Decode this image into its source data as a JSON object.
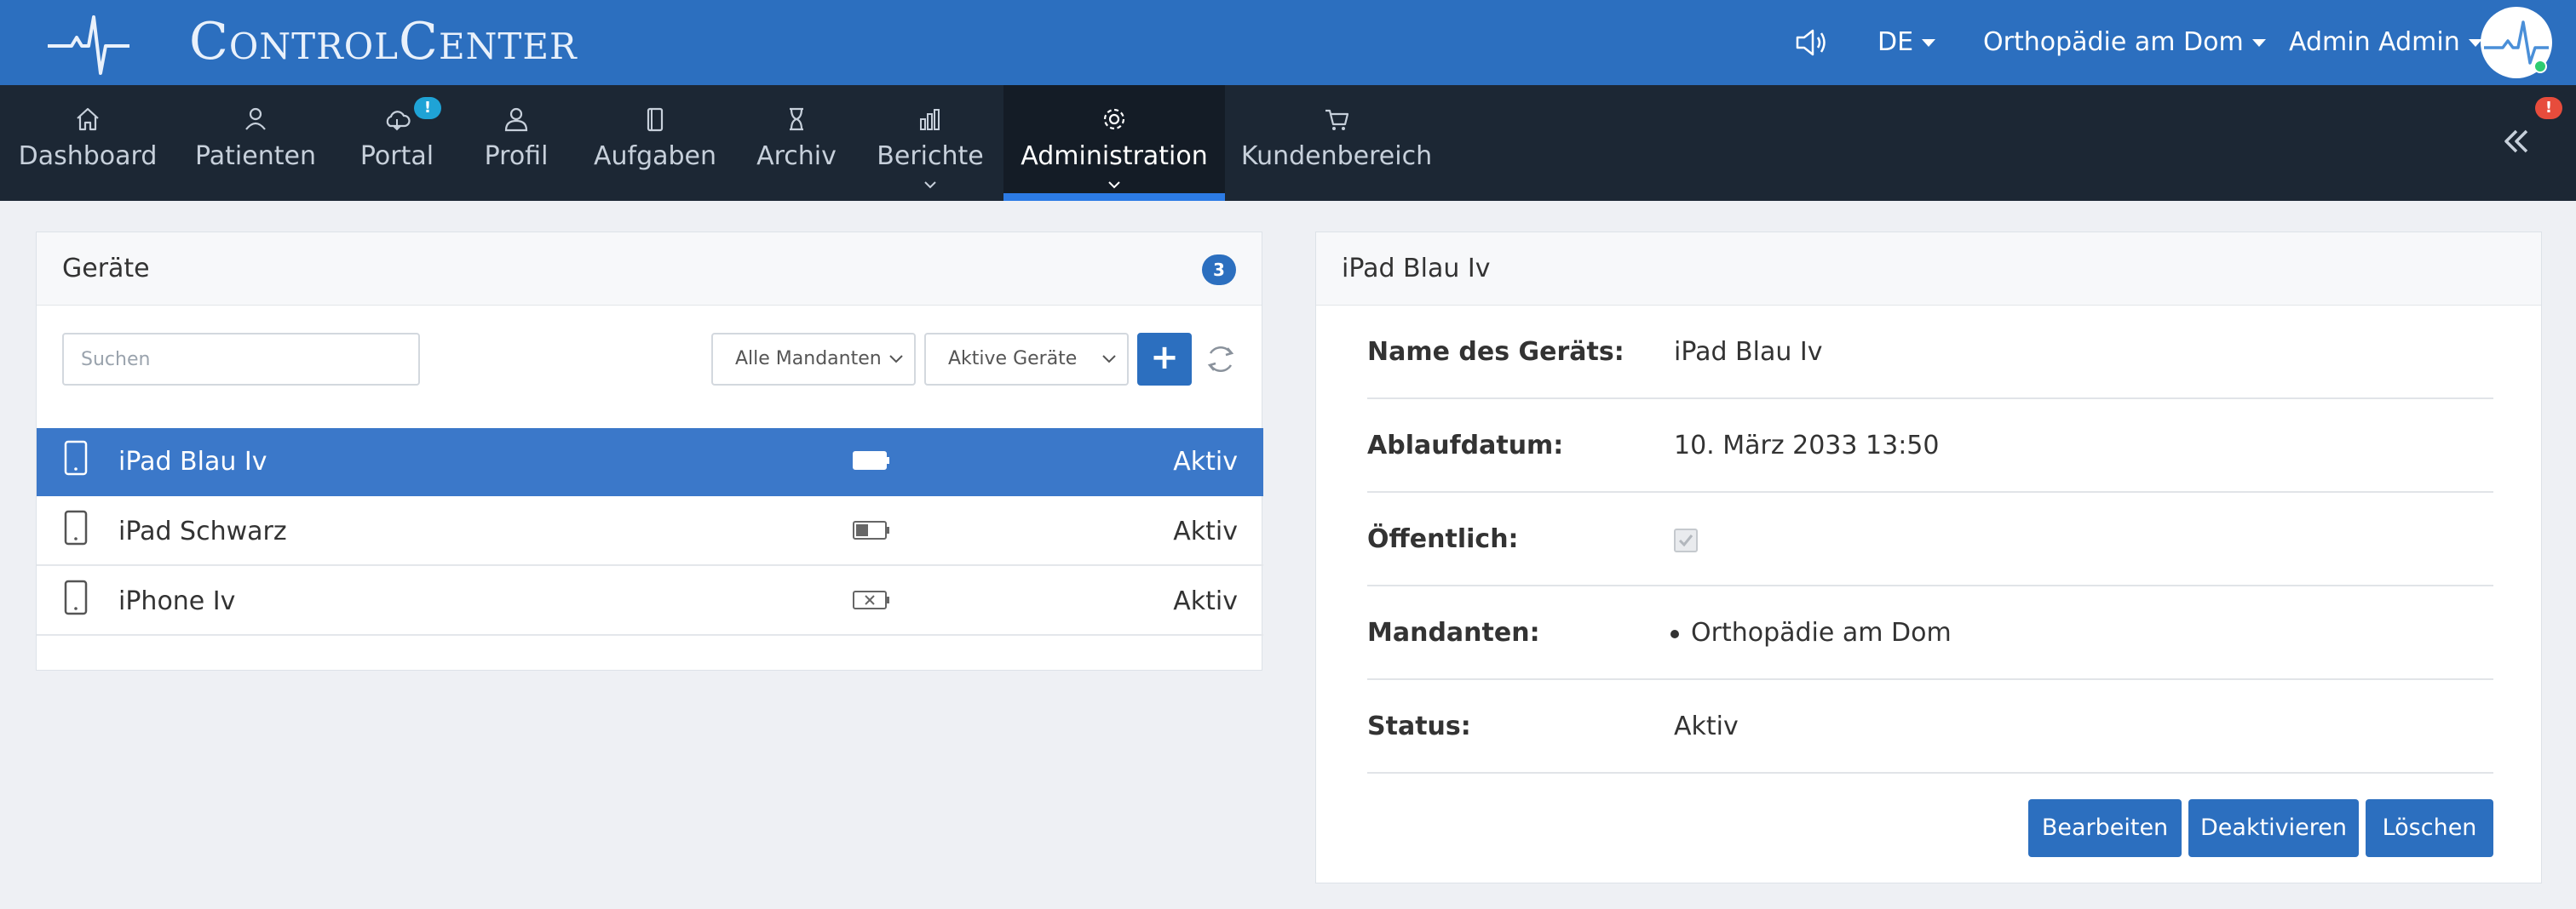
{
  "app": {
    "title": "ControlCenter",
    "accent": "#2c6fbf",
    "nav_bg": "#1c2734"
  },
  "header": {
    "language": "DE",
    "organization": "Orthopädie am Dom",
    "user": "Admin Admin",
    "icons": [
      "pulse-logo-icon",
      "speaker-icon",
      "avatar"
    ]
  },
  "nav": {
    "items": [
      {
        "label": "Dashboard",
        "icon": "home-icon"
      },
      {
        "label": "Patienten",
        "icon": "users-icon"
      },
      {
        "label": "Portal",
        "icon": "cloud-icon",
        "badge": "!"
      },
      {
        "label": "Profil",
        "icon": "user-icon"
      },
      {
        "label": "Aufgaben",
        "icon": "clipboard-icon"
      },
      {
        "label": "Archiv",
        "icon": "hourglass-icon"
      },
      {
        "label": "Berichte",
        "icon": "bar-chart-icon"
      },
      {
        "label": "Administration",
        "icon": "gear-icon"
      },
      {
        "label": "Kundenbereich",
        "icon": "cart-icon"
      }
    ],
    "active": "Administration",
    "collapse_badge": "!"
  },
  "devices_panel": {
    "title": "Geräte",
    "count": "3",
    "search_placeholder": "Suchen",
    "filter_clients": "Alle Mandanten",
    "filter_status": "Aktive Geräte",
    "add_label": "+",
    "rows": [
      {
        "name": "iPad Blau Iv",
        "battery": "full",
        "status": "Aktiv",
        "selected": true
      },
      {
        "name": "iPad Schwarz",
        "battery": "half",
        "status": "Aktiv",
        "selected": false
      },
      {
        "name": "iPhone Iv",
        "battery": "none",
        "status": "Aktiv",
        "selected": false
      }
    ]
  },
  "detail_panel": {
    "title": "iPad Blau Iv",
    "fields": {
      "name_label": "Name des Geräts:",
      "name_value": "iPad Blau Iv",
      "expiry_label": "Ablaufdatum:",
      "expiry_value": "10. März 2033 13:50",
      "public_label": "Öffentlich:",
      "public_value": true,
      "clients_label": "Mandanten:",
      "clients_value": "Orthopädie am Dom",
      "status_label": "Status:",
      "status_value": "Aktiv"
    },
    "buttons": {
      "edit": "Bearbeiten",
      "deactivate": "Deaktivieren",
      "delete": "Löschen"
    }
  }
}
